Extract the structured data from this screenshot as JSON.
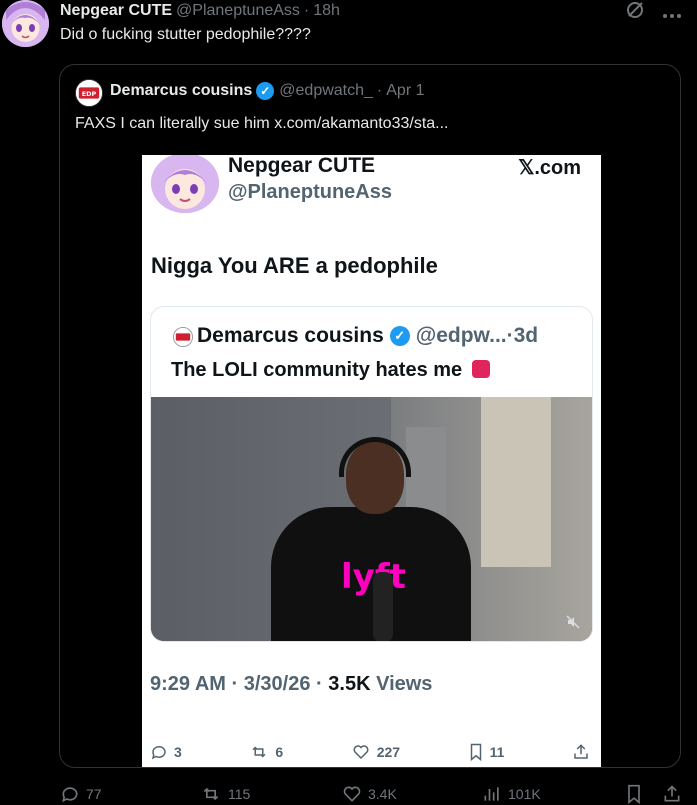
{
  "tweet": {
    "author_name": "Nepgear CUTE",
    "author_handle": "@PlaneptuneAss",
    "separator": "·",
    "time": "18h",
    "text": "Did o fucking stutter pedophile????",
    "menu_icon": "more-icon",
    "grok_icon": "grok-icon"
  },
  "quote": {
    "author_name": "Demarcus cousins",
    "author_handle": "@edpwatch_",
    "separator": "·",
    "time": "Apr 1",
    "text": "FAXS I can literally sue him  x.com/akamanto33/sta...",
    "avatar_label": "EDP WATCH",
    "embedded": {
      "author_name": "Nepgear CUTE",
      "author_handle": "@PlaneptuneAss",
      "site": "𝕏.com",
      "text": "Nigga You ARE a pedophile",
      "inner": {
        "author_name": "Demarcus cousins",
        "author_handle": "@edpw...",
        "time": "3d",
        "separator": "·",
        "text": "The LOLI community hates me",
        "video_logo": "lyft"
      },
      "meta": {
        "time": "9:29 AM",
        "date": "3/30/26",
        "views_count": "3.5K",
        "views_label": "Views",
        "separator": "·"
      },
      "actions": {
        "replies": "3",
        "reposts": "6",
        "likes": "227",
        "bookmarks": "11"
      }
    }
  },
  "actions": {
    "replies": "77",
    "reposts": "115",
    "likes": "3.4K",
    "views": "101K"
  },
  "colors": {
    "background": "#000000",
    "text": "#e7e9ea",
    "muted": "#71767b",
    "verified": "#1d9bf0",
    "border": "#2f3336"
  }
}
